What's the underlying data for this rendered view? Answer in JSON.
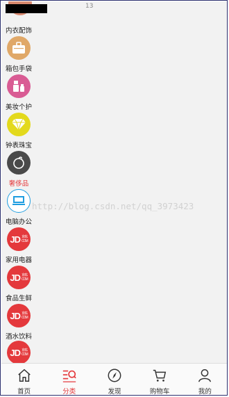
{
  "status_number": "13",
  "watermark": "http://blog.csdn.net/qq_3973423",
  "categories": [
    {
      "label": "内衣配饰",
      "icon": "lingerie-icon",
      "color": "#d8896f"
    },
    {
      "label": "箱包手袋",
      "icon": "bag-icon",
      "color": "#e0a868"
    },
    {
      "label": "美妆个护",
      "icon": "cosmetics-icon",
      "color": "#d95c94"
    },
    {
      "label": "钟表珠宝",
      "icon": "diamond-icon",
      "color": "#e3d91c"
    },
    {
      "label": "奢侈品",
      "icon": "luxury-icon",
      "color": "#4a4a4a"
    },
    {
      "label": "电脑办公",
      "icon": "computer-icon",
      "color": "#1e9de0"
    },
    {
      "label": "家用电器",
      "icon": "jd-logo-icon",
      "color": "#e4393c"
    },
    {
      "label": "食品生鲜",
      "icon": "jd-logo-icon",
      "color": "#e4393c"
    },
    {
      "label": "酒水饮料",
      "icon": "jd-logo-icon",
      "color": "#e4393c"
    },
    {
      "label": "",
      "icon": "jd-logo-icon",
      "color": "#e4393c"
    }
  ],
  "jd_logo": {
    "main": "JD",
    "sub_top": "京东",
    "sub_bottom": "COM"
  },
  "tabs": [
    {
      "label": "首页",
      "icon": "home-icon"
    },
    {
      "label": "分类",
      "icon": "category-search-icon"
    },
    {
      "label": "发现",
      "icon": "compass-icon"
    },
    {
      "label": "购物车",
      "icon": "cart-icon"
    },
    {
      "label": "我的",
      "icon": "user-icon"
    }
  ],
  "colors": {
    "accent": "#e4393c",
    "background": "#f2f2f2"
  }
}
